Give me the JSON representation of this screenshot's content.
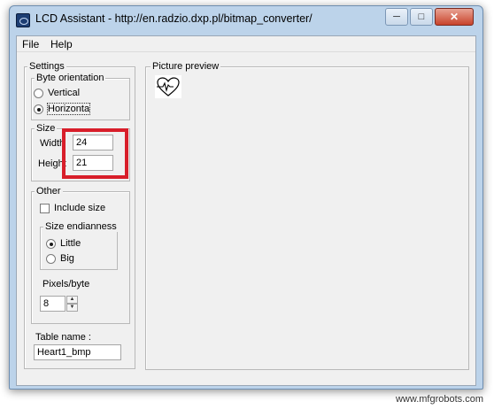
{
  "window": {
    "title": "LCD Assistant -  http://en.radzio.dxp.pl/bitmap_converter/"
  },
  "menu": [
    "File",
    "Help"
  ],
  "settings": {
    "legend": "Settings",
    "byte_orientation": {
      "legend": "Byte orientation",
      "options": [
        "Vertical",
        "Horizonta"
      ],
      "selected": "Horizonta"
    },
    "size": {
      "legend": "Size",
      "width_label": "Width",
      "height_label": "Height",
      "width": "24",
      "height": "21"
    },
    "other": {
      "legend": "Other",
      "include_size_label": "Include size",
      "include_size": false,
      "endianness": {
        "legend": "Size endianness",
        "options": [
          "Little",
          "Big"
        ],
        "selected": "Little"
      },
      "pixels_per_byte_label": "Pixels/byte",
      "pixels_per_byte": "8"
    },
    "table_name_label": "Table name :",
    "table_name": "Heart1_bmp"
  },
  "preview": {
    "legend": "Picture preview",
    "image": "heart-pulse-bitmap"
  },
  "watermark": "www.mfgrobots.com",
  "highlight_color": "#d81e2a"
}
